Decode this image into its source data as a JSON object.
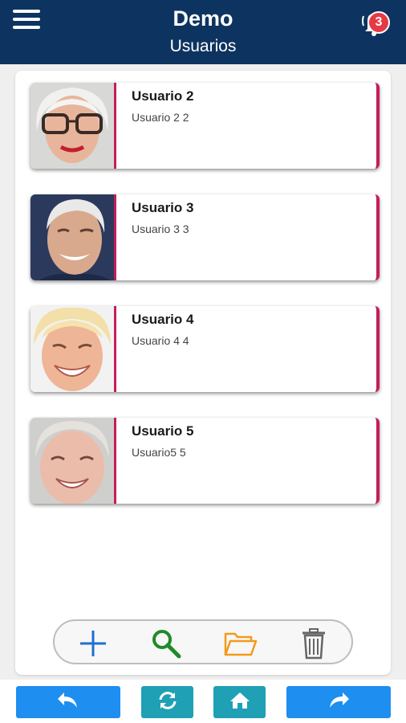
{
  "header": {
    "title": "Demo",
    "subtitle": "Usuarios",
    "notification_count": "3"
  },
  "users": [
    {
      "name": "Usuario 2",
      "detail": "Usuario 2 2"
    },
    {
      "name": "Usuario 3",
      "detail": "Usuario 3 3"
    },
    {
      "name": "Usuario 4",
      "detail": "Usuario 4 4"
    },
    {
      "name": "Usuario 5",
      "detail": "Usuario5 5"
    }
  ],
  "toolbar": {
    "icons": [
      "plus-icon",
      "search-icon",
      "folder-open-icon",
      "trash-icon"
    ]
  },
  "nav": {
    "icons": [
      "undo-icon",
      "refresh-icon",
      "home-icon",
      "redo-icon"
    ]
  },
  "colors": {
    "header_bg": "#0d3460",
    "accent": "#c41d5c",
    "badge": "#e53946",
    "nav_blue": "#1e8ef0",
    "nav_teal": "#1fa0b5"
  }
}
